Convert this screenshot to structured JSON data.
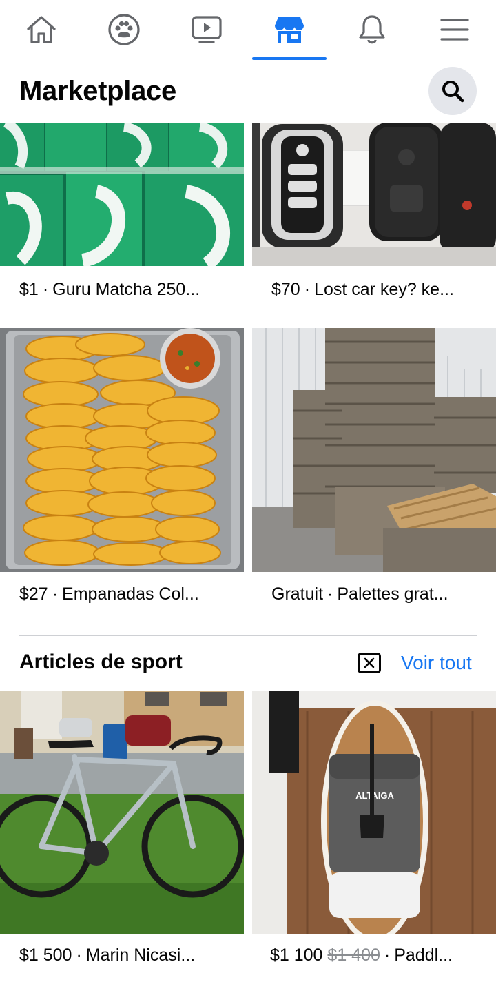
{
  "nav": {
    "items": [
      {
        "icon": "home-icon",
        "active": false
      },
      {
        "icon": "groups-icon",
        "active": false
      },
      {
        "icon": "watch-icon",
        "active": false
      },
      {
        "icon": "marketplace-icon",
        "active": true
      },
      {
        "icon": "notifications-icon",
        "active": false
      },
      {
        "icon": "menu-icon",
        "active": false
      }
    ]
  },
  "header": {
    "title": "Marketplace",
    "search_icon": "search-icon"
  },
  "listings": [
    {
      "price": "$1",
      "title": "Guru Matcha 250..."
    },
    {
      "price": "$70",
      "title": "Lost car key? ke..."
    },
    {
      "price": "$27",
      "title": "Empanadas Col..."
    },
    {
      "price": "Gratuit",
      "title": "Palettes grat..."
    }
  ],
  "section": {
    "title": "Articles de sport",
    "hide_icon": "close-box-icon",
    "see_all": "Voir tout",
    "listings": [
      {
        "price": "$1 500",
        "title": "Marin Nicasi..."
      },
      {
        "price": "$1 100",
        "old_price": "$1 400",
        "title": "Paddl..."
      }
    ]
  },
  "colors": {
    "accent": "#1877f2",
    "text": "#050505",
    "secondary": "#8a8d91",
    "divider": "#ced0d4",
    "button_bg": "#e4e6eb"
  }
}
